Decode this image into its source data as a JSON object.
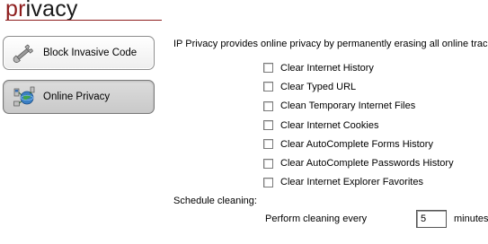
{
  "header": {
    "title_accent": "pr",
    "title_rest": "ivacy"
  },
  "nav": {
    "items": [
      {
        "label": "Block Invasive Code",
        "icon": "wrench-icon",
        "active": false
      },
      {
        "label": "Online Privacy",
        "icon": "network-globe-icon",
        "active": true
      }
    ]
  },
  "main": {
    "intro": "IP Privacy provides online privacy by permanently erasing all online tracks",
    "options": [
      {
        "label": "Clear Internet History",
        "checked": false
      },
      {
        "label": "Clear Typed URL",
        "checked": false
      },
      {
        "label": "Clean Temporary Internet Files",
        "checked": false
      },
      {
        "label": "Clear Internet Cookies",
        "checked": false
      },
      {
        "label": "Clear AutoComplete Forms History",
        "checked": false
      },
      {
        "label": "Clear AutoComplete Passwords History",
        "checked": false
      },
      {
        "label": "Clear Internet Explorer Favorites",
        "checked": false
      }
    ],
    "schedule_label": "Schedule cleaning:",
    "perform_label": "Perform cleaning every",
    "interval_value": "5",
    "interval_unit": "minutes"
  },
  "colors": {
    "accent": "#8e1e1e"
  }
}
